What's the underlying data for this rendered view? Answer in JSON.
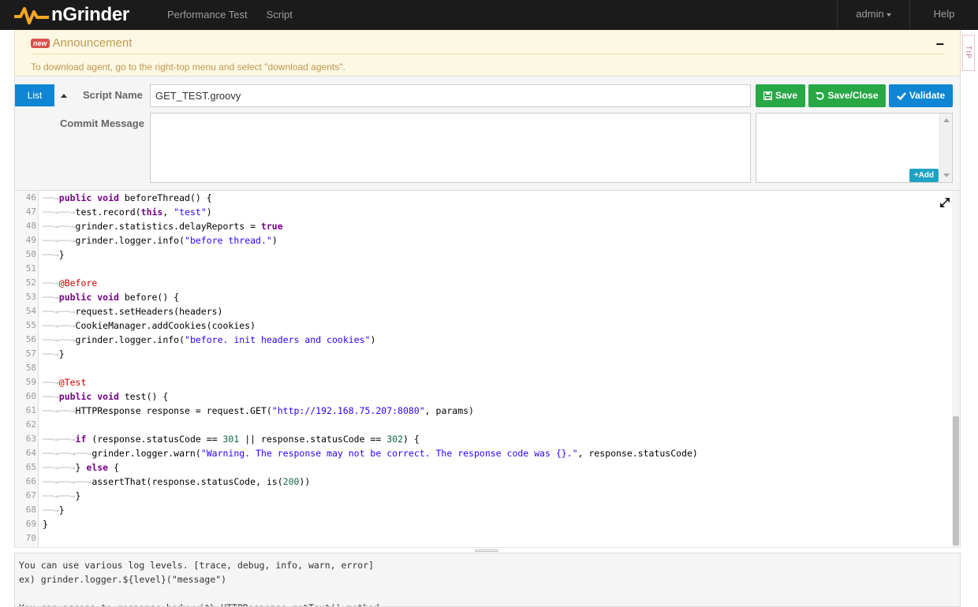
{
  "navbar": {
    "brand": "nGrinder",
    "menu": [
      "Performance Test",
      "Script"
    ],
    "user": "admin",
    "help": "Help"
  },
  "announcement": {
    "badge": "new",
    "title": "Announcement",
    "toggle": "−",
    "text": "To download agent, go to the right-top menu and select \"download agents\"."
  },
  "tip": "TIP",
  "form": {
    "list_label": "List",
    "script_name_label": "Script Name",
    "script_name_value": "GET_TEST.groovy",
    "commit_label": "Commit Message",
    "save_label": "Save",
    "save_close_label": "Save/Close",
    "validate_label": "Validate",
    "add_label": "Add"
  },
  "editor": {
    "lines": [
      {
        "n": "46",
        "t": [
          [
            "tab",
            "──→"
          ],
          [
            "kw",
            "public void"
          ],
          [
            "",
            "beforeThread() {"
          ]
        ]
      },
      {
        "n": "47",
        "t": [
          [
            "tab",
            "──→──→"
          ],
          [
            "",
            "test.record("
          ],
          [
            "kw",
            "this"
          ],
          [
            "",
            ", "
          ],
          [
            "str",
            "\"test\""
          ],
          [
            "",
            ")"
          ]
        ]
      },
      {
        "n": "48",
        "t": [
          [
            "tab",
            "──→──→"
          ],
          [
            "",
            "grinder.statistics.delayReports = "
          ],
          [
            "kw",
            "true"
          ]
        ]
      },
      {
        "n": "49",
        "t": [
          [
            "tab",
            "──→──→"
          ],
          [
            "",
            "grinder.logger.info("
          ],
          [
            "str",
            "\"before thread.\""
          ],
          [
            "",
            ")"
          ]
        ]
      },
      {
        "n": "50",
        "t": [
          [
            "tab",
            "──→"
          ],
          [
            "",
            "}"
          ]
        ]
      },
      {
        "n": "51",
        "t": []
      },
      {
        "n": "52",
        "t": [
          [
            "tab",
            "──→"
          ],
          [
            "ann",
            "@Before"
          ]
        ]
      },
      {
        "n": "53",
        "t": [
          [
            "tab",
            "──→"
          ],
          [
            "kw",
            "public void"
          ],
          [
            "",
            "before() {"
          ]
        ]
      },
      {
        "n": "54",
        "t": [
          [
            "tab",
            "──→──→"
          ],
          [
            "",
            "request.setHeaders(headers)"
          ]
        ]
      },
      {
        "n": "55",
        "t": [
          [
            "tab",
            "──→──→"
          ],
          [
            "",
            "CookieManager.addCookies(cookies)"
          ]
        ]
      },
      {
        "n": "56",
        "t": [
          [
            "tab",
            "──→──→"
          ],
          [
            "",
            "grinder.logger.info("
          ],
          [
            "str",
            "\"before. init headers and cookies\""
          ],
          [
            "",
            ")"
          ]
        ]
      },
      {
        "n": "57",
        "t": [
          [
            "tab",
            "──→"
          ],
          [
            "",
            "}"
          ]
        ]
      },
      {
        "n": "58",
        "t": []
      },
      {
        "n": "59",
        "t": [
          [
            "tab",
            "──→"
          ],
          [
            "ann",
            "@Test"
          ]
        ]
      },
      {
        "n": "60",
        "t": [
          [
            "tab",
            "──→"
          ],
          [
            "kw",
            "public void"
          ],
          [
            "",
            "test() {"
          ]
        ]
      },
      {
        "n": "61",
        "t": [
          [
            "tab",
            "──→──→"
          ],
          [
            "",
            "HTTPResponse response = request.GET("
          ],
          [
            "str",
            "\"http://192.168.75.207:8080\""
          ],
          [
            "",
            ", params)"
          ]
        ]
      },
      {
        "n": "62",
        "t": []
      },
      {
        "n": "63",
        "t": [
          [
            "tab",
            "──→──→"
          ],
          [
            "kw",
            "if"
          ],
          [
            "",
            " (response.statusCode == "
          ],
          [
            "num",
            "301"
          ],
          [
            "",
            " || response.statusCode == "
          ],
          [
            "num",
            "302"
          ],
          [
            "",
            ") {"
          ]
        ]
      },
      {
        "n": "64",
        "t": [
          [
            "tab",
            "──→──→──→"
          ],
          [
            "",
            "grinder.logger.warn("
          ],
          [
            "str",
            "\"Warning. The response may not be correct. The response code was {}.\""
          ],
          [
            "",
            ", response.statusCode)"
          ]
        ]
      },
      {
        "n": "65",
        "t": [
          [
            "tab",
            "──→──→"
          ],
          [
            "",
            "} "
          ],
          [
            "kw",
            "else"
          ],
          [
            "",
            " {"
          ]
        ]
      },
      {
        "n": "66",
        "t": [
          [
            "tab",
            "──→──→──→"
          ],
          [
            "",
            "assertThat(response.statusCode, is("
          ],
          [
            "num",
            "200"
          ],
          [
            "",
            "))"
          ]
        ]
      },
      {
        "n": "67",
        "t": [
          [
            "tab",
            "──→──→"
          ],
          [
            "",
            "}"
          ]
        ]
      },
      {
        "n": "68",
        "t": [
          [
            "tab",
            "──→"
          ],
          [
            "",
            "}"
          ]
        ]
      },
      {
        "n": "69",
        "t": [
          [
            "",
            "}"
          ]
        ]
      },
      {
        "n": "70",
        "t": []
      }
    ]
  },
  "help": {
    "lines": [
      "You can use various log levels. [trace, debug, info, warn, error]",
      "ex) grinder.logger.${level}(\"message\")",
      "",
      "You can access to response body with HTTPResponse.getText() method."
    ]
  },
  "colors": {
    "navbar": "#1b1b1b",
    "brand_orange": "#f5a623",
    "primary_blue": "#0e86d4",
    "save_green": "#28a745",
    "announce_bg": "#fcf8e3"
  }
}
